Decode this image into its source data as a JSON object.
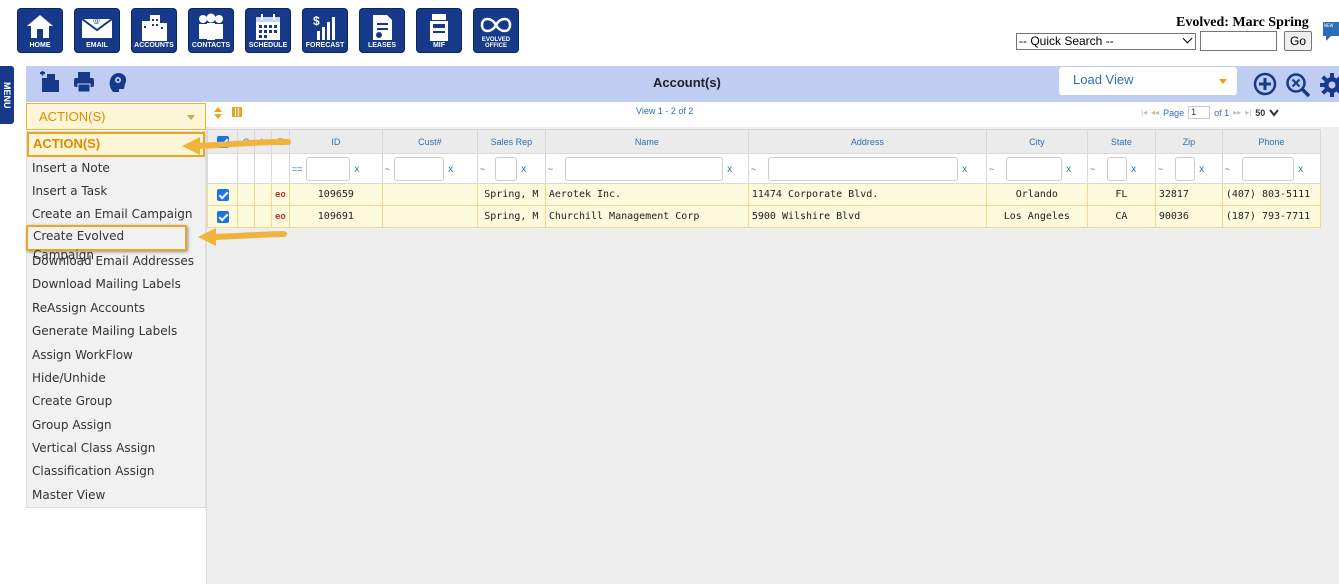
{
  "nav": [
    {
      "label": "HOME",
      "icon": "home-icon"
    },
    {
      "label": "EMAIL",
      "icon": "email-icon"
    },
    {
      "label": "ACCOUNTS",
      "icon": "accounts-icon"
    },
    {
      "label": "CONTACTS",
      "icon": "contacts-icon"
    },
    {
      "label": "SCHEDULE",
      "icon": "schedule-icon"
    },
    {
      "label": "FORECAST",
      "icon": "forecast-icon"
    },
    {
      "label": "LEASES",
      "icon": "leases-icon"
    },
    {
      "label": "MIF",
      "icon": "mif-icon"
    },
    {
      "label": "EVOLVED OFFICE",
      "icon": "evolved-office-icon"
    }
  ],
  "header": {
    "user": "Evolved: Marc Spring",
    "quick_search": "-- Quick Search --",
    "go": "Go",
    "menu_tab": "MENU"
  },
  "toolbar": {
    "title": "Account(s)",
    "load_view": "Load View"
  },
  "actions": {
    "selected": "ACTION(S)",
    "items": [
      "ACTION(S)",
      "Insert a Note",
      "Insert a Task",
      "Create an Email Campaign",
      "Create Evolved Campaign",
      "Download Email Addresses",
      "Download Mailing Labels",
      "ReAssign Accounts",
      "Generate Mailing Labels",
      "Assign WorkFlow",
      "Hide/Unhide",
      "Create Group",
      "Group Assign",
      "Vertical Class Assign",
      "Classification Assign",
      "Master View"
    ]
  },
  "pager": {
    "view": "View 1 - 2 of 2",
    "page_label": "Page",
    "page": "1",
    "of": "of 1",
    "size": "50"
  },
  "columns": {
    "c": "C",
    "l": "L",
    "e": "E",
    "id": "ID",
    "cust": "Cust#",
    "rep": "Sales Rep",
    "name": "Name",
    "address": "Address",
    "city": "City",
    "state": "State",
    "zip": "Zip",
    "phone": "Phone"
  },
  "filter": {
    "eq": "==",
    "tilde": "~",
    "x": "x"
  },
  "rows": [
    {
      "id": "109659",
      "cust": "",
      "rep": "Spring, M",
      "name": "Aerotek Inc.",
      "address": "11474 Corporate Blvd.",
      "city": "Orlando",
      "state": "FL",
      "zip": "32817",
      "phone": "(407) 803-5111",
      "flag": "eo"
    },
    {
      "id": "109691",
      "cust": "",
      "rep": "Spring, M",
      "name": "Churchill Management Corp",
      "address": "5900 Wilshire Blvd",
      "city": "Los Angeles",
      "state": "CA",
      "zip": "90036",
      "phone": "(187) 793-7711",
      "flag": "eo"
    }
  ],
  "colors": {
    "nav_blue": "#17398a",
    "header_bar": "#bfcdf3",
    "highlight": "#e8a623",
    "row_bg": "#fcf9dc"
  }
}
